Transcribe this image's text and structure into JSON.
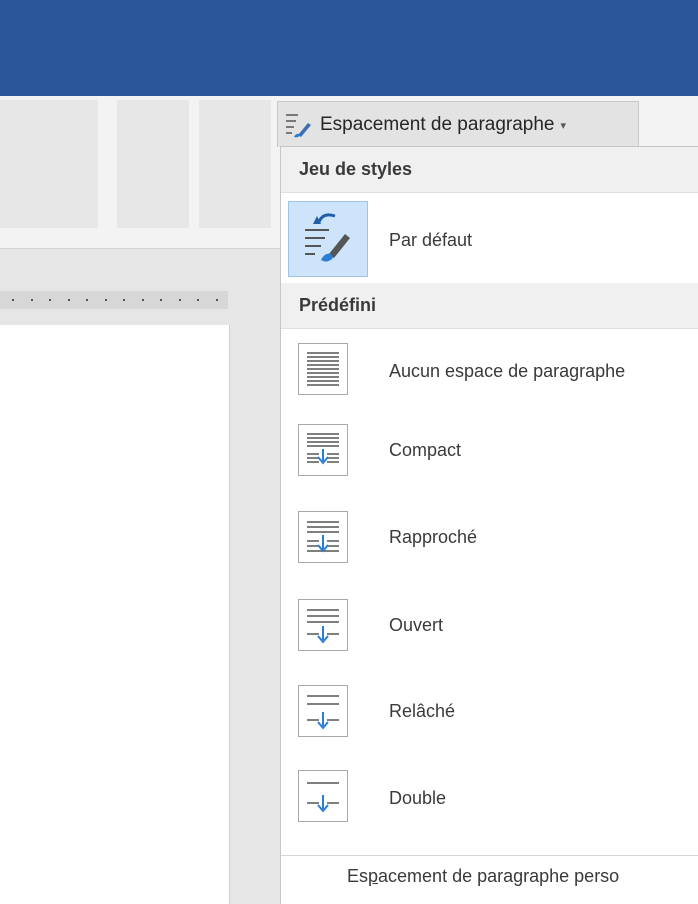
{
  "ribbon": {
    "paragraph_spacing_button": {
      "label": "Espacement de paragraphe",
      "icon": "paragraph-spacing-icon",
      "caret_icon": "chevron-down-icon"
    }
  },
  "menu": {
    "style_set_section": {
      "heading": "Jeu de styles"
    },
    "style_set_items": [
      {
        "label": "Par défaut",
        "icon": "reset-style-brush-icon",
        "selected": true
      }
    ],
    "builtin_section": {
      "heading": "Prédéfini"
    },
    "builtin_items": [
      {
        "label": "Aucun espace de paragraphe",
        "icon": "no-spacing-icon"
      },
      {
        "label": "Compact",
        "icon": "compact-spacing-icon"
      },
      {
        "label": "Rapproché",
        "icon": "tight-spacing-icon"
      },
      {
        "label": "Ouvert",
        "icon": "open-spacing-icon"
      },
      {
        "label": "Relâché",
        "icon": "relaxed-spacing-icon"
      },
      {
        "label": "Double",
        "icon": "double-spacing-icon"
      }
    ],
    "custom_item": {
      "label_before": "Es",
      "label_accel": "p",
      "label_after": "acement de paragraphe perso"
    }
  },
  "colors": {
    "titlebar": "#2b579a",
    "selection_fill": "#cde4fb",
    "selection_border": "#9ec4ec",
    "arrow_blue": "#2a7fd4"
  }
}
